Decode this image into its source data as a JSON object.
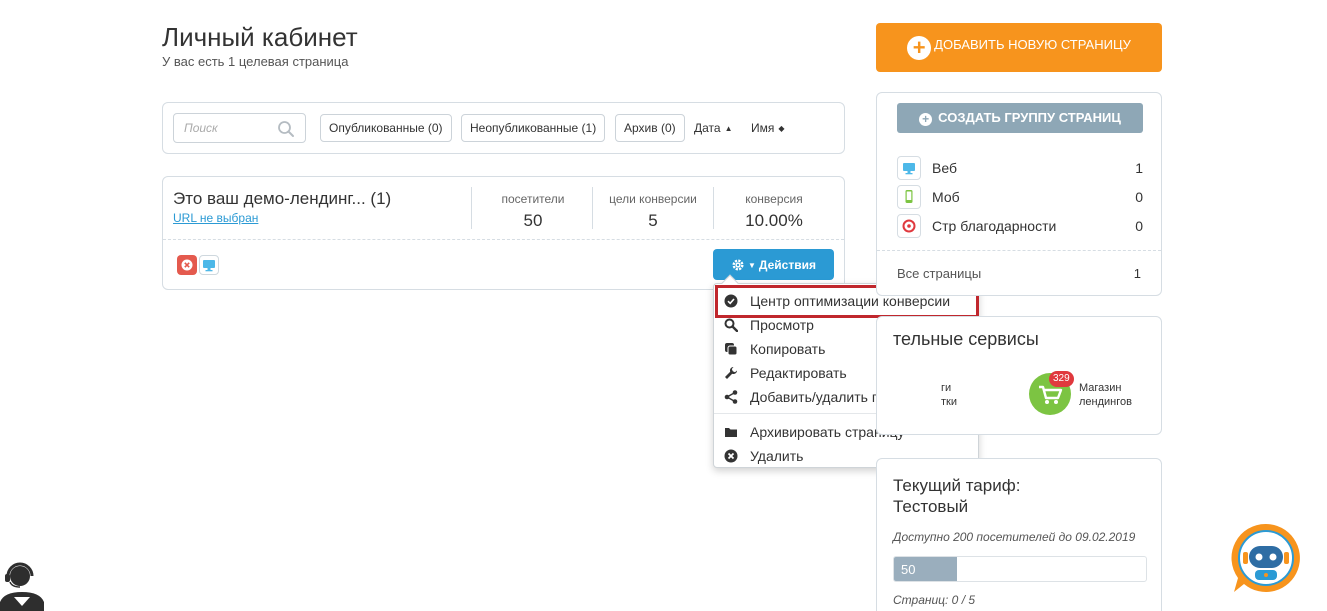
{
  "header": {
    "title": "Личный кабинет",
    "subtitle": "У вас есть 1 целевая страница"
  },
  "filters": {
    "search_placeholder": "Поиск",
    "published": "Опубликованные (0)",
    "unpublished": "Неопубликованные (1)",
    "archive": "Архив (0)",
    "sort_date": "Дата",
    "sort_name": "Имя"
  },
  "landing": {
    "title": "Это ваш демо-лендинг... (1)",
    "url_text": "URL не выбран",
    "stats": [
      {
        "label": "посетители",
        "value": "50"
      },
      {
        "label": "цели конверсии",
        "value": "5"
      },
      {
        "label": "конверсия",
        "value": "10.00%"
      }
    ],
    "actions_label": "Действия"
  },
  "dropdown": {
    "items": [
      {
        "label": "Центр оптимизации конверсии",
        "icon": "check-circle-icon"
      },
      {
        "label": "Просмотр",
        "icon": "search-icon"
      },
      {
        "label": "Копировать",
        "icon": "copy-icon"
      },
      {
        "label": "Редактировать",
        "icon": "wrench-icon"
      },
      {
        "label": "Добавить/удалить группы",
        "icon": "share-icon"
      },
      {
        "label": "Архивировать страницу",
        "icon": "folder-icon"
      },
      {
        "label": "Удалить",
        "icon": "times-circle-icon"
      }
    ],
    "highlight_color": "#c0272d"
  },
  "sidebar": {
    "add_page": "ДОБАВИТЬ НОВУЮ СТРАНИЦУ",
    "create_group": "СОЗДАТЬ ГРУППУ СТРАНИЦ",
    "groups": [
      {
        "label": "Веб",
        "count": "1",
        "icon": "monitor-icon"
      },
      {
        "label": "Моб",
        "count": "0",
        "icon": "mobile-icon"
      },
      {
        "label": "Стр благодарности",
        "count": "0",
        "icon": "thanks-icon"
      }
    ],
    "all_pages_label": "Все страницы",
    "all_pages_count": "1"
  },
  "services": {
    "title": "тельные сервисы",
    "left_service": "ги\nтки",
    "store_badge": "329",
    "store_label": "Магазин\nлендингов"
  },
  "tariff": {
    "title": "Текущий тариф:\nТестовый",
    "note": "Доступно 200 посетителей до 09.02.2019",
    "progress_value": "50",
    "progress_max": 200,
    "pages_note": "Страниц: 0 / 5"
  },
  "colors": {
    "accent_orange": "#f7941d",
    "accent_blue": "#2b9ad4",
    "group_button": "#8ea7b6",
    "danger": "#e45a4e"
  }
}
